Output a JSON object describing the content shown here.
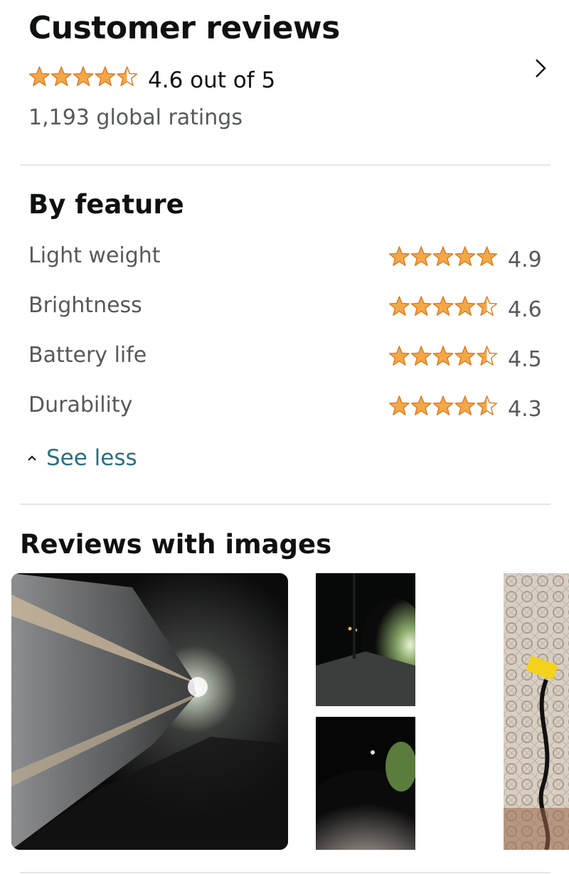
{
  "header": {
    "title": "Customer reviews",
    "rating_text": "4.6 out of 5",
    "rating_value": 4.6,
    "global_ratings": "1,193 global ratings"
  },
  "by_feature": {
    "title": "By feature",
    "features": [
      {
        "label": "Light weight",
        "score": "4.9",
        "stars": 5
      },
      {
        "label": "Brightness",
        "score": "4.6",
        "stars": 4.5
      },
      {
        "label": "Battery life",
        "score": "4.5",
        "stars": 4.5
      },
      {
        "label": "Durability",
        "score": "4.3",
        "stars": 4.5
      }
    ],
    "see_less": "See less"
  },
  "reviews_with_images": {
    "title": "Reviews with images"
  },
  "colors": {
    "star": "#f3a847",
    "star_outline": "#de7921",
    "link": "#2a6f7f",
    "secondary_text": "#565959",
    "divider": "#e3e6e6"
  },
  "icons": [
    "chevron-right-icon",
    "caret-up-icon",
    "star-icon"
  ]
}
